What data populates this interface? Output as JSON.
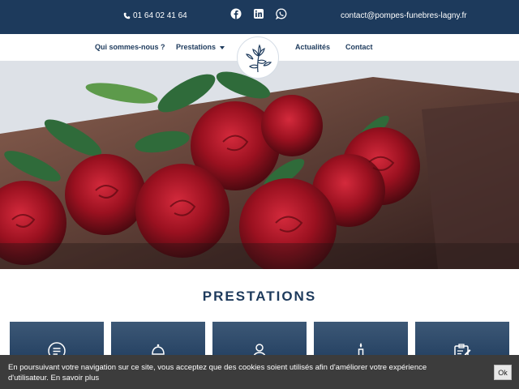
{
  "topbar": {
    "phone": "01 64 02 41 64",
    "email": "contact@pompes-funebres-lagny.fr",
    "socials": [
      "facebook-icon",
      "linkedin-icon",
      "whatsapp-icon"
    ]
  },
  "nav": {
    "items": [
      {
        "label": "Qui sommes-nous ?"
      },
      {
        "label": "Prestations",
        "dropdown": true
      },
      {
        "label": "Actualités"
      },
      {
        "label": "Contact"
      }
    ]
  },
  "hero": {
    "image": "red-roses-on-coffin"
  },
  "section": {
    "title": "PRESTATIONS",
    "cards": [
      "document-icon",
      "bell-icon",
      "person-icon",
      "candle-icon",
      "clipboard-icon"
    ]
  },
  "cookie": {
    "text": "En poursuivant votre navigation sur ce site, vous acceptez que des cookies soient utilisés afin d'améliorer votre expérience d'utilisateur.",
    "link": "En savoir plus",
    "ok": "Ok"
  },
  "colors": {
    "primary": "#1d3a5c",
    "banner": "#3c3c3c",
    "rose": "#9b1120"
  }
}
